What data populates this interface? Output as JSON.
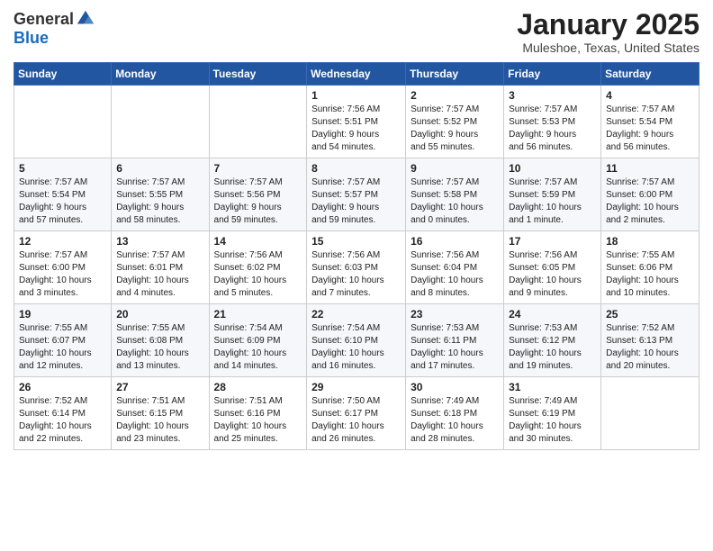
{
  "logo": {
    "general": "General",
    "blue": "Blue"
  },
  "title": "January 2025",
  "subtitle": "Muleshoe, Texas, United States",
  "weekdays": [
    "Sunday",
    "Monday",
    "Tuesday",
    "Wednesday",
    "Thursday",
    "Friday",
    "Saturday"
  ],
  "weeks": [
    [
      {
        "day": "",
        "info": ""
      },
      {
        "day": "",
        "info": ""
      },
      {
        "day": "",
        "info": ""
      },
      {
        "day": "1",
        "info": "Sunrise: 7:56 AM\nSunset: 5:51 PM\nDaylight: 9 hours\nand 54 minutes."
      },
      {
        "day": "2",
        "info": "Sunrise: 7:57 AM\nSunset: 5:52 PM\nDaylight: 9 hours\nand 55 minutes."
      },
      {
        "day": "3",
        "info": "Sunrise: 7:57 AM\nSunset: 5:53 PM\nDaylight: 9 hours\nand 56 minutes."
      },
      {
        "day": "4",
        "info": "Sunrise: 7:57 AM\nSunset: 5:54 PM\nDaylight: 9 hours\nand 56 minutes."
      }
    ],
    [
      {
        "day": "5",
        "info": "Sunrise: 7:57 AM\nSunset: 5:54 PM\nDaylight: 9 hours\nand 57 minutes."
      },
      {
        "day": "6",
        "info": "Sunrise: 7:57 AM\nSunset: 5:55 PM\nDaylight: 9 hours\nand 58 minutes."
      },
      {
        "day": "7",
        "info": "Sunrise: 7:57 AM\nSunset: 5:56 PM\nDaylight: 9 hours\nand 59 minutes."
      },
      {
        "day": "8",
        "info": "Sunrise: 7:57 AM\nSunset: 5:57 PM\nDaylight: 9 hours\nand 59 minutes."
      },
      {
        "day": "9",
        "info": "Sunrise: 7:57 AM\nSunset: 5:58 PM\nDaylight: 10 hours\nand 0 minutes."
      },
      {
        "day": "10",
        "info": "Sunrise: 7:57 AM\nSunset: 5:59 PM\nDaylight: 10 hours\nand 1 minute."
      },
      {
        "day": "11",
        "info": "Sunrise: 7:57 AM\nSunset: 6:00 PM\nDaylight: 10 hours\nand 2 minutes."
      }
    ],
    [
      {
        "day": "12",
        "info": "Sunrise: 7:57 AM\nSunset: 6:00 PM\nDaylight: 10 hours\nand 3 minutes."
      },
      {
        "day": "13",
        "info": "Sunrise: 7:57 AM\nSunset: 6:01 PM\nDaylight: 10 hours\nand 4 minutes."
      },
      {
        "day": "14",
        "info": "Sunrise: 7:56 AM\nSunset: 6:02 PM\nDaylight: 10 hours\nand 5 minutes."
      },
      {
        "day": "15",
        "info": "Sunrise: 7:56 AM\nSunset: 6:03 PM\nDaylight: 10 hours\nand 7 minutes."
      },
      {
        "day": "16",
        "info": "Sunrise: 7:56 AM\nSunset: 6:04 PM\nDaylight: 10 hours\nand 8 minutes."
      },
      {
        "day": "17",
        "info": "Sunrise: 7:56 AM\nSunset: 6:05 PM\nDaylight: 10 hours\nand 9 minutes."
      },
      {
        "day": "18",
        "info": "Sunrise: 7:55 AM\nSunset: 6:06 PM\nDaylight: 10 hours\nand 10 minutes."
      }
    ],
    [
      {
        "day": "19",
        "info": "Sunrise: 7:55 AM\nSunset: 6:07 PM\nDaylight: 10 hours\nand 12 minutes."
      },
      {
        "day": "20",
        "info": "Sunrise: 7:55 AM\nSunset: 6:08 PM\nDaylight: 10 hours\nand 13 minutes."
      },
      {
        "day": "21",
        "info": "Sunrise: 7:54 AM\nSunset: 6:09 PM\nDaylight: 10 hours\nand 14 minutes."
      },
      {
        "day": "22",
        "info": "Sunrise: 7:54 AM\nSunset: 6:10 PM\nDaylight: 10 hours\nand 16 minutes."
      },
      {
        "day": "23",
        "info": "Sunrise: 7:53 AM\nSunset: 6:11 PM\nDaylight: 10 hours\nand 17 minutes."
      },
      {
        "day": "24",
        "info": "Sunrise: 7:53 AM\nSunset: 6:12 PM\nDaylight: 10 hours\nand 19 minutes."
      },
      {
        "day": "25",
        "info": "Sunrise: 7:52 AM\nSunset: 6:13 PM\nDaylight: 10 hours\nand 20 minutes."
      }
    ],
    [
      {
        "day": "26",
        "info": "Sunrise: 7:52 AM\nSunset: 6:14 PM\nDaylight: 10 hours\nand 22 minutes."
      },
      {
        "day": "27",
        "info": "Sunrise: 7:51 AM\nSunset: 6:15 PM\nDaylight: 10 hours\nand 23 minutes."
      },
      {
        "day": "28",
        "info": "Sunrise: 7:51 AM\nSunset: 6:16 PM\nDaylight: 10 hours\nand 25 minutes."
      },
      {
        "day": "29",
        "info": "Sunrise: 7:50 AM\nSunset: 6:17 PM\nDaylight: 10 hours\nand 26 minutes."
      },
      {
        "day": "30",
        "info": "Sunrise: 7:49 AM\nSunset: 6:18 PM\nDaylight: 10 hours\nand 28 minutes."
      },
      {
        "day": "31",
        "info": "Sunrise: 7:49 AM\nSunset: 6:19 PM\nDaylight: 10 hours\nand 30 minutes."
      },
      {
        "day": "",
        "info": ""
      }
    ]
  ]
}
